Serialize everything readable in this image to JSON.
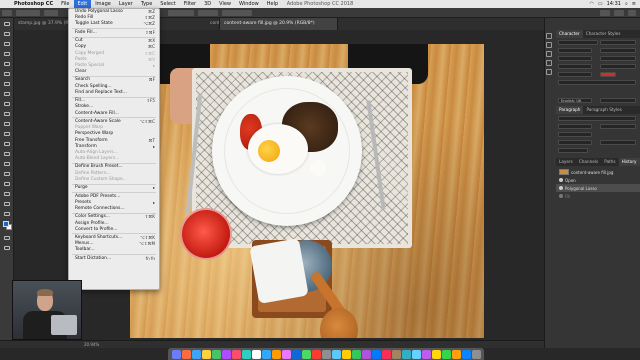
{
  "menubar": {
    "app_name": "Photoshop CC",
    "items": [
      "File",
      "Edit",
      "Image",
      "Layer",
      "Type",
      "Select",
      "Filter",
      "3D",
      "View",
      "Window",
      "Help"
    ],
    "window_title": "Adobe Photoshop CC 2018",
    "clock": "14:31"
  },
  "tabs": [
    {
      "label": "stamp.jpg @ 37.9% (RGB/8*)"
    },
    {
      "label": "content-aware.jpg @ 24.7% (RGB/8*)"
    },
    {
      "label": "content-aware fill.jpg @ 20.9% (RGB/8*)"
    }
  ],
  "edit_menu": {
    "items": [
      {
        "label": "Undo Polygonal Lasso",
        "shortcut": "⌘Z",
        "enabled": true
      },
      {
        "label": "Redo Fill",
        "shortcut": "⇧⌘Z",
        "enabled": true
      },
      {
        "label": "Toggle Last State",
        "shortcut": "⌥⌘Z",
        "enabled": true
      },
      {
        "sep": true
      },
      {
        "label": "Fade Fill...",
        "shortcut": "⇧⌘F",
        "enabled": true
      },
      {
        "sep": true
      },
      {
        "label": "Cut",
        "shortcut": "⌘X",
        "enabled": true
      },
      {
        "label": "Copy",
        "shortcut": "⌘C",
        "enabled": true
      },
      {
        "label": "Copy Merged",
        "shortcut": "⇧⌘C",
        "enabled": false
      },
      {
        "label": "Paste",
        "shortcut": "⌘V",
        "enabled": false
      },
      {
        "label": "Paste Special",
        "shortcut": "▸",
        "enabled": false
      },
      {
        "label": "Clear",
        "shortcut": "",
        "enabled": true
      },
      {
        "sep": true
      },
      {
        "label": "Search",
        "shortcut": "⌘F",
        "enabled": true
      },
      {
        "label": "Check Spelling...",
        "shortcut": "",
        "enabled": true
      },
      {
        "label": "Find and Replace Text...",
        "shortcut": "",
        "enabled": true
      },
      {
        "sep": true
      },
      {
        "label": "Fill...",
        "shortcut": "⇧F5",
        "enabled": true
      },
      {
        "label": "Stroke...",
        "shortcut": "",
        "enabled": true
      },
      {
        "label": "Content-Aware Fill...",
        "shortcut": "",
        "enabled": true
      },
      {
        "sep": true
      },
      {
        "label": "Content-Aware Scale",
        "shortcut": "⌥⇧⌘C",
        "enabled": true
      },
      {
        "label": "Puppet Warp",
        "shortcut": "",
        "enabled": false
      },
      {
        "label": "Perspective Warp",
        "shortcut": "",
        "enabled": true
      },
      {
        "label": "Free Transform",
        "shortcut": "⌘T",
        "enabled": true
      },
      {
        "label": "Transform",
        "shortcut": "▸",
        "enabled": true
      },
      {
        "label": "Auto-Align Layers...",
        "shortcut": "",
        "enabled": false
      },
      {
        "label": "Auto-Blend Layers...",
        "shortcut": "",
        "enabled": false
      },
      {
        "sep": true
      },
      {
        "label": "Define Brush Preset...",
        "shortcut": "",
        "enabled": true
      },
      {
        "label": "Define Pattern...",
        "shortcut": "",
        "enabled": false
      },
      {
        "label": "Define Custom Shape...",
        "shortcut": "",
        "enabled": false
      },
      {
        "sep": true
      },
      {
        "label": "Purge",
        "shortcut": "▸",
        "enabled": true
      },
      {
        "sep": true
      },
      {
        "label": "Adobe PDF Presets...",
        "shortcut": "",
        "enabled": true
      },
      {
        "label": "Presets",
        "shortcut": "▸",
        "enabled": true
      },
      {
        "label": "Remote Connections...",
        "shortcut": "",
        "enabled": true
      },
      {
        "sep": true
      },
      {
        "label": "Color Settings...",
        "shortcut": "⇧⌘K",
        "enabled": true
      },
      {
        "label": "Assign Profile...",
        "shortcut": "",
        "enabled": true
      },
      {
        "label": "Convert to Profile...",
        "shortcut": "",
        "enabled": true
      },
      {
        "sep": true
      },
      {
        "label": "Keyboard Shortcuts...",
        "shortcut": "⌥⇧⌘K",
        "enabled": true
      },
      {
        "label": "Menus...",
        "shortcut": "⌥⇧⌘M",
        "enabled": true
      },
      {
        "label": "Toolbar...",
        "shortcut": "",
        "enabled": true
      },
      {
        "sep": true
      },
      {
        "label": "Start Dictation...",
        "shortcut": "fn fn",
        "enabled": true
      }
    ]
  },
  "right_panels": {
    "character_tabs": [
      "Character",
      "Character Styles"
    ],
    "paragraph_tabs": [
      "Paragraph",
      "Paragraph Styles"
    ],
    "layers_tabs": [
      "Layers",
      "Channels",
      "Paths",
      "History"
    ],
    "language": "English: UK",
    "history_items": [
      "content-aware fill.jpg",
      "Open",
      "Polygonal Lasso",
      "Fill"
    ]
  },
  "statusbar": {
    "zoom": "20.94%"
  },
  "colors": {
    "accent": "#2f6fdb",
    "panel": "#353535"
  }
}
